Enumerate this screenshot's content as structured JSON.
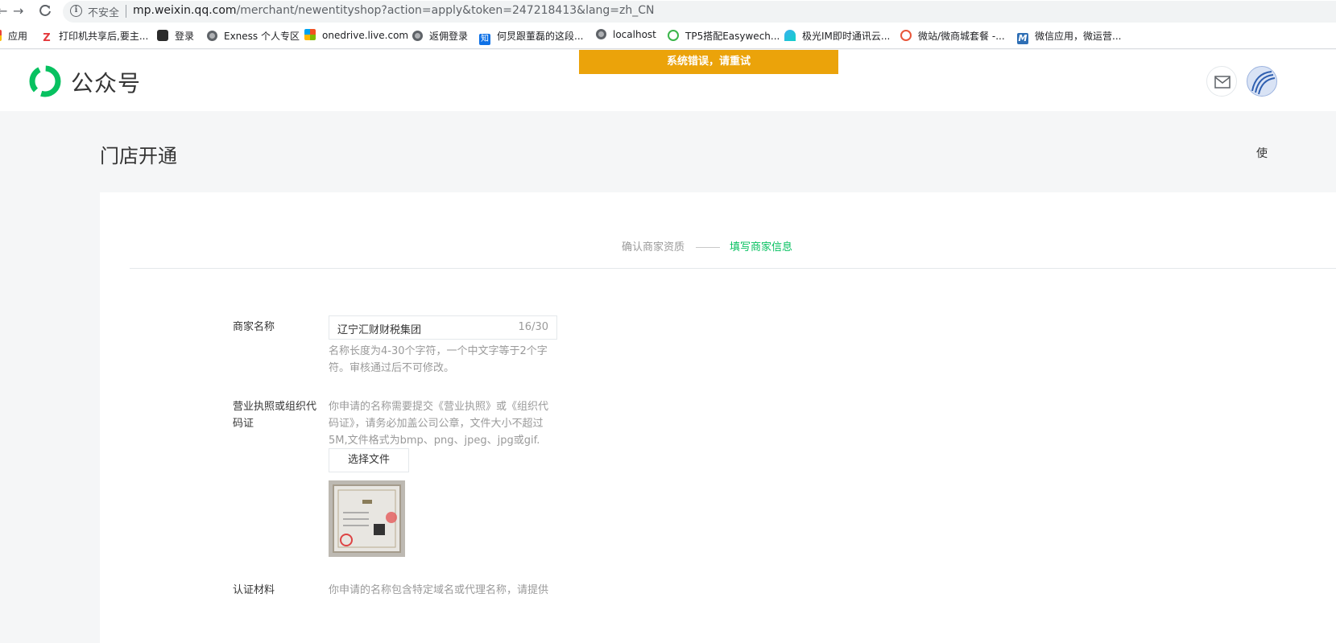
{
  "browser": {
    "insecure_label": "不安全",
    "url_host": "mp.weixin.qq.com",
    "url_path": "/merchant/newentityshop?action=apply&token=247218413&lang=zh_CN"
  },
  "bookmarks": [
    {
      "label": "应用"
    },
    {
      "label": "打印机共享后,要主..."
    },
    {
      "label": "登录"
    },
    {
      "label": "Exness 个人专区"
    },
    {
      "label": "onedrive.live.com"
    },
    {
      "label": "返佣登录"
    },
    {
      "label": "何炅跟董磊的这段..."
    },
    {
      "label": "localhost"
    },
    {
      "label": "TP5搭配Easywech..."
    },
    {
      "label": "极光IM即时通讯云..."
    },
    {
      "label": "微站/微商城套餐 -..."
    },
    {
      "label": "微信应用，微运营..."
    }
  ],
  "header": {
    "logo_text": "公众号",
    "error_toast": "系统错误，请重试"
  },
  "page": {
    "title": "门店开通",
    "side_text": "使"
  },
  "steps": {
    "step1": "确认商家资质",
    "step2": "填写商家信息"
  },
  "form": {
    "name_label": "商家名称",
    "name_value": "辽宁汇财财税集团",
    "name_count": "16/30",
    "name_tip": "名称长度为4-30个字符，一个中文字等于2个字符。审核通过后不可修改。",
    "license_label": "营业执照或组织代码证",
    "license_tip": "你申请的名称需要提交《营业执照》或《组织代码证》，请务必加盖公司公章，文件大小不超过5M,文件格式为bmp、png、jpeg、jpg或gif.",
    "choose_file": "选择文件",
    "next_label": "认证材料",
    "next_tip": "你申请的名称包含特定域名或代理名称，请提供"
  }
}
